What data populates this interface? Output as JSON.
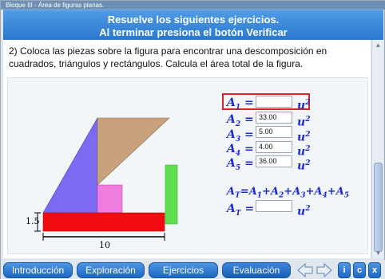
{
  "window": {
    "breadcrumb": "Bloque III  -  Área de figuras planas."
  },
  "header": {
    "line1": "Resuelve los siguientes ejercicios.",
    "line2": "Al terminar presiona el botón Verificar"
  },
  "exercise": {
    "prompt": "2) Coloca las piezas sobre la figura para encontrar una descomposición en cuadrados, triángulos y rectángulos. Calcula el área total de la figura.",
    "dimension_height": "1.5",
    "dimension_width": "10"
  },
  "areas": [
    {
      "var": "A",
      "sub": "1",
      "eq": "=",
      "value": "",
      "unit": "u",
      "exp": "2"
    },
    {
      "var": "A",
      "sub": "2",
      "eq": "=",
      "value": "33.00",
      "unit": "u",
      "exp": "2"
    },
    {
      "var": "A",
      "sub": "3",
      "eq": "=",
      "value": "5.00",
      "unit": "u",
      "exp": "2"
    },
    {
      "var": "A",
      "sub": "4",
      "eq": "=",
      "value": "4.00",
      "unit": "u",
      "exp": "2"
    },
    {
      "var": "A",
      "sub": "5",
      "eq": "=",
      "value": "36.00",
      "unit": "u",
      "exp": "2"
    }
  ],
  "total": {
    "formula_lhs": "A",
    "formula_lhs_sub": "T",
    "formula_rhs": "=A",
    "t1": "1",
    "t2": "2",
    "t3": "3",
    "t4": "4",
    "t5": "5",
    "plus": "+A",
    "result_var": "A",
    "result_sub": "T",
    "result_eq": "=",
    "result_value": "",
    "unit": "u",
    "exp": "2"
  },
  "nav": {
    "intro": "Introducción",
    "explore": "Exploración",
    "exercises": "Ejercicios",
    "evaluation": "Evaluación",
    "info": "i",
    "credits": "c",
    "close": "x"
  },
  "colors": {
    "header": "#2b78cf",
    "triangle_blue": "#7a6bf2",
    "trapezoid_tan": "#c8a27c",
    "square_pink": "#f07ce0",
    "rect_red": "#f20c12",
    "rect_green": "#5fe04e",
    "highlight": "#d6252b",
    "math_text": "#1f2bd0"
  }
}
